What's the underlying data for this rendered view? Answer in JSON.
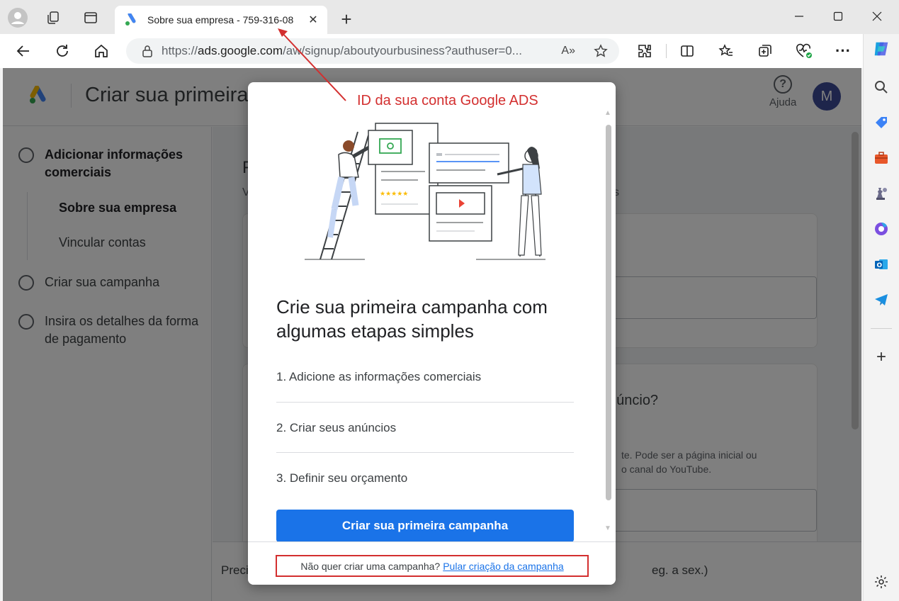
{
  "browser": {
    "tab_title": "Sobre sua empresa - 759-316-08",
    "url_prefix": "https://",
    "url_domain": "ads.google.com",
    "url_rest": "/aw/signup/aboutyourbusiness?authuser=0..."
  },
  "header": {
    "title": "Criar sua primeira c",
    "help_label": "Ajuda",
    "avatar_letter": "M"
  },
  "sidebar": {
    "steps": [
      {
        "label": "Adicionar informações comerciais"
      },
      {
        "label": "Criar sua campanha"
      },
      {
        "label": "Insira os detalhes da forma de pagamento"
      }
    ],
    "substeps": [
      {
        "label": "Sobre sua empresa"
      },
      {
        "label": "Vincular contas"
      }
    ]
  },
  "background": {
    "heading_fragment": "F",
    "sub_fragment": "V",
    "tail_fragment": "s",
    "question_fragment": "núncio?",
    "desc_line1": "te. Pode ser a página inicial ou",
    "desc_line2": "o canal do YouTube.",
    "footer_left": "Preci",
    "footer_right": "eg. a sex.)"
  },
  "dialog": {
    "title": "Crie sua primeira campanha com algumas etapas simples",
    "steps": [
      "1. Adicione as informações comerciais",
      "2. Criar seus anúncios",
      "3. Definir seu orçamento"
    ],
    "cta": "Criar sua primeira campanha",
    "skip_text": "Não quer criar uma campanha?",
    "skip_link": "Pular criação da campanha"
  },
  "annotation": {
    "text": "ID da sua conta Google ADS",
    "color": "#d32f2f"
  },
  "colors": {
    "accent": "#1a73e8",
    "annotation": "#d32f2f"
  }
}
